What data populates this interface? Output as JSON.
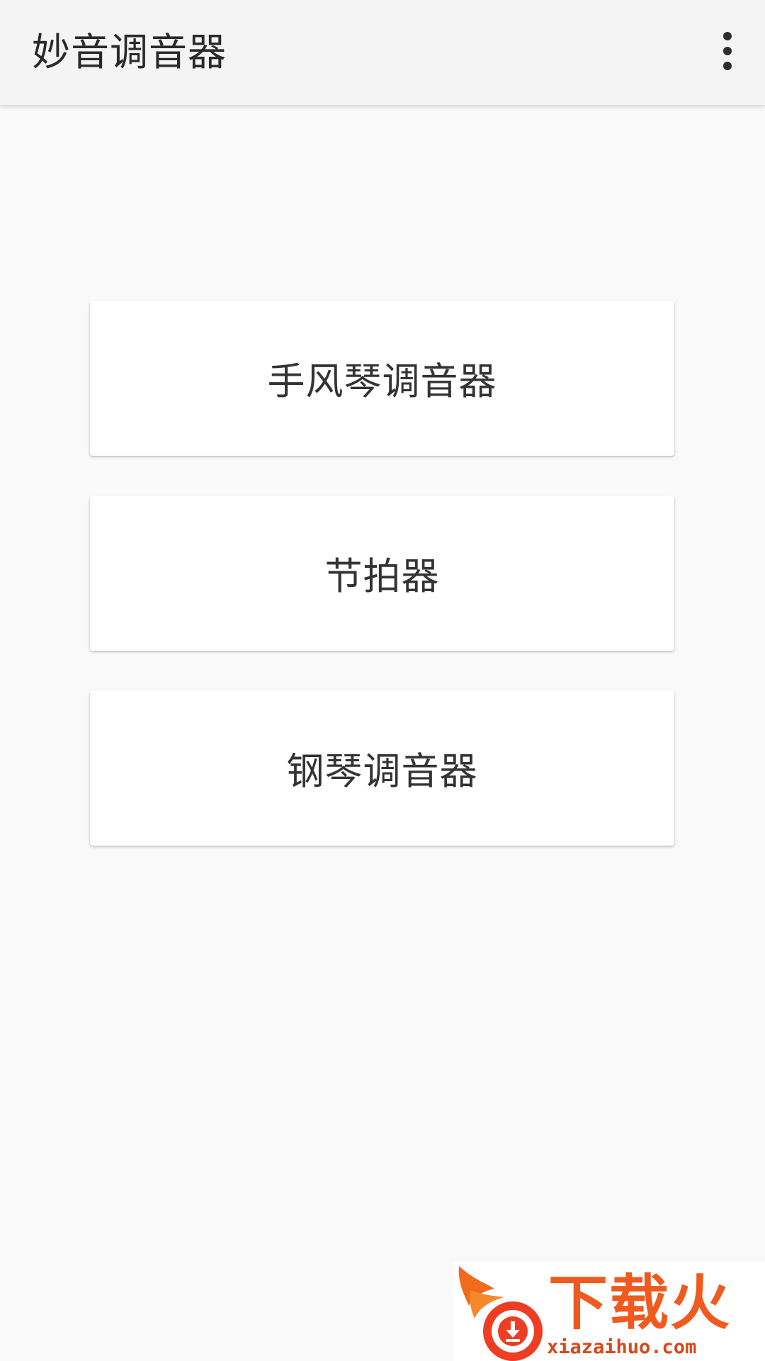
{
  "appbar": {
    "title": "妙音调音器",
    "overflow_icon": "more-vert-icon"
  },
  "menu": {
    "items": [
      {
        "label": "手风琴调音器"
      },
      {
        "label": "节拍器"
      },
      {
        "label": "钢琴调音器"
      }
    ]
  },
  "watermark": {
    "brand": "下载火",
    "url": "xiazaihuo.com",
    "accent": "#f05a1e"
  },
  "colors": {
    "background": "#f9f9f9",
    "appbar": "#f4f4f4",
    "card": "#ffffff",
    "text": "#333333"
  }
}
